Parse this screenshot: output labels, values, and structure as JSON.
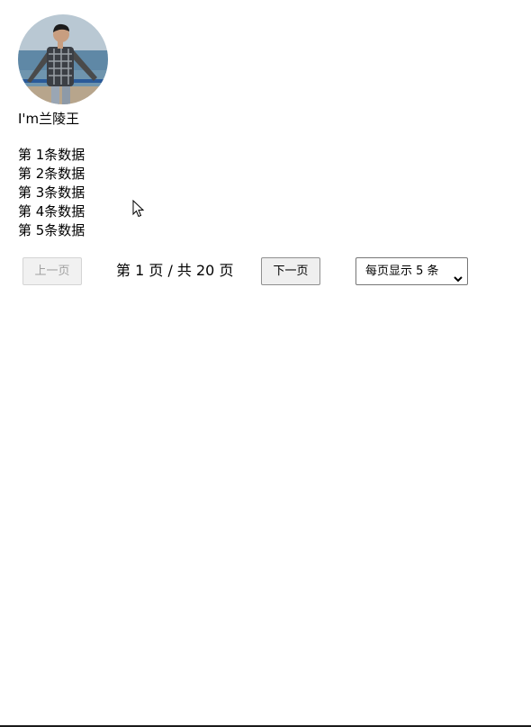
{
  "profile": {
    "name": "I'm兰陵王"
  },
  "items": [
    "第 1条数据",
    "第 2条数据",
    "第 3条数据",
    "第 4条数据",
    "第 5条数据"
  ],
  "pagination": {
    "prev_label": "上一页",
    "next_label": "下一页",
    "page_info": "第 1 页 / 共 20 页",
    "page_size_selected": "每页显示 5 条"
  }
}
